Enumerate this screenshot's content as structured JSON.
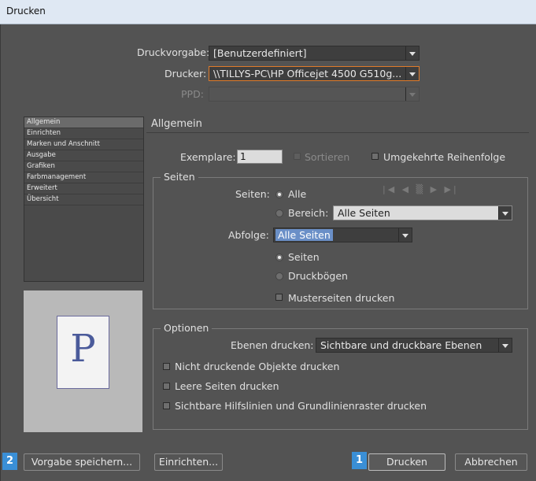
{
  "window": {
    "title": "Drucken"
  },
  "top": {
    "druckvorgabe_label": "Druckvorgabe:",
    "druckvorgabe_value": "[Benutzerdefiniert]",
    "drucker_label": "Drucker:",
    "drucker_value": "\\\\TILLYS-PC\\HP Officejet 4500 G510g...",
    "ppd_label": "PPD:"
  },
  "sidebar": {
    "items": [
      "Allgemein",
      "Einrichten",
      "Marken und Anschnitt",
      "Ausgabe",
      "Grafiken",
      "Farbmanagement",
      "Erweitert",
      "Übersicht"
    ]
  },
  "preview": {
    "letter": "P"
  },
  "section_title": "Allgemein",
  "general": {
    "exemplare_label": "Exemplare:",
    "exemplare_value": "1",
    "sortieren_label": "Sortieren",
    "umgekehrt_label": "Umgekehrte Reihenfolge"
  },
  "seiten_group": {
    "title": "Seiten",
    "seiten_label": "Seiten:",
    "alle_label": "Alle",
    "bereich_label": "Bereich:",
    "bereich_value": "Alle Seiten",
    "abfolge_label": "Abfolge:",
    "abfolge_value": "Alle Seiten",
    "seiten_radio_label": "Seiten",
    "druckbogen_label": "Druckbögen",
    "musterseiten_label": "Musterseiten drucken",
    "nav_glyphs": "|◀ ◀ ▒ ▶ ▶|"
  },
  "optionen_group": {
    "title": "Optionen",
    "ebenen_label": "Ebenen drucken:",
    "ebenen_value": "Sichtbare und druckbare Ebenen",
    "nicht_druckende_label": "Nicht druckende Objekte drucken",
    "leere_seiten_label": "Leere Seiten drucken",
    "hilfslinien_label": "Sichtbare Hilfslinien und Grundlinienraster drucken"
  },
  "buttons": {
    "vorgabe_speichern": "Vorgabe speichern...",
    "einrichten": "Einrichten...",
    "drucken": "Drucken",
    "abbrechen": "Abbrechen"
  },
  "badges": {
    "one": "1",
    "two": "2"
  },
  "colors": {
    "accent_orange": "#e07b2a",
    "badge_blue": "#3a8fd6",
    "dialog_bg": "#535353"
  }
}
